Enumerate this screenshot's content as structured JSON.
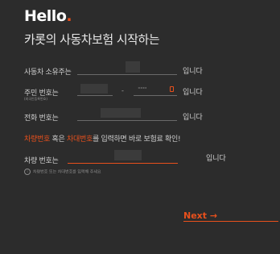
{
  "header": {
    "title": "Hello",
    "title_dot": ".",
    "subtitle": "카롯의 사동차보험 시작하는"
  },
  "form": {
    "owner": {
      "label": "사동차 소유주는",
      "suffix": "입니다"
    },
    "resident": {
      "label": "주민 번호는",
      "sublabel": "(외국인등록번호)",
      "separator": "-",
      "masked": "·······",
      "suffix": "입니다"
    },
    "phone": {
      "label": "전화 번호는",
      "suffix": "입니다"
    },
    "notice": {
      "part1": "차량번호",
      "part2": " 혹은 ",
      "part3": "차대번호",
      "part4": "를 입력하면 바로 보험료 확인!"
    },
    "car": {
      "label": "차량 번호는",
      "suffix": "입니다"
    },
    "hint": "차량번호 또는 차대번호를 입력해 주세요"
  },
  "footer": {
    "next_label": "Next →"
  },
  "colors": {
    "accent": "#e8501c",
    "background": "#2c2c2c"
  }
}
